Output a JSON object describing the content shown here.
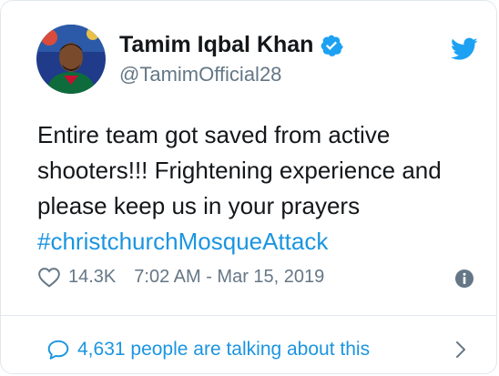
{
  "tweet": {
    "author_name": "Tamim Iqbal Khan",
    "handle": "@TamimOfficial28",
    "text_lines": [
      "Entire team got saved from active",
      "shooters!!! Frightening experience and",
      "please keep us in your prayers"
    ],
    "hashtag": "#christchurchMosqueAttack",
    "likes": "14.3K",
    "timestamp": "7:02 AM - Mar 15, 2019",
    "talking": "4,631 people are talking about this"
  },
  "icons": {
    "verified": "verified-badge-icon",
    "logo": "twitter-bird-icon",
    "like": "heart-icon",
    "info": "info-icon",
    "reply": "speech-bubble-icon",
    "more": "chevron-right-icon"
  },
  "colors": {
    "brand": "#1da1f2",
    "link": "#1b95e0",
    "muted": "#657786",
    "text": "#14171a"
  }
}
